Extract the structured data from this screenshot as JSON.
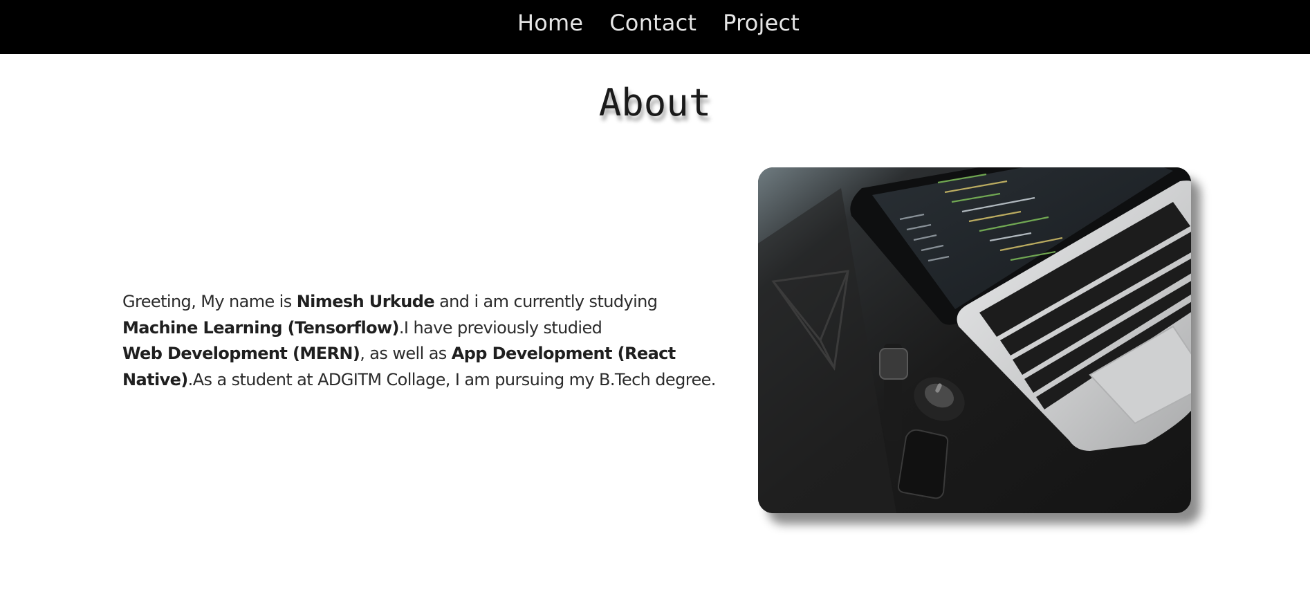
{
  "nav": {
    "items": [
      {
        "label": "Home"
      },
      {
        "label": "Contact"
      },
      {
        "label": "Project"
      }
    ]
  },
  "about": {
    "title": "About",
    "paragraph": [
      {
        "text": "Greeting, My name is ",
        "bold": false
      },
      {
        "text": "Nimesh Urkude",
        "bold": true
      },
      {
        "text": " and i am currently studying",
        "bold": false
      },
      {
        "text": "Machine Learning (Tensorflow)",
        "bold": true
      },
      {
        "text": ".I have previously studied",
        "bold": false
      },
      {
        "text": "Web Development (MERN)",
        "bold": true
      },
      {
        "text": ", as well as ",
        "bold": false
      },
      {
        "text": "App Development (React Native)",
        "bold": true
      },
      {
        "text": ".As a student at ADGITM Collage, I am pursuing my B.Tech degree.",
        "bold": false
      }
    ]
  },
  "image": {
    "alt": "Laptop with code on a dark desk with watch, mouse and phone"
  },
  "colors": {
    "nav_bg": "#000000",
    "nav_text": "#e6e6e6",
    "body_text": "#2b2b2b",
    "page_bg": "#ffffff"
  }
}
